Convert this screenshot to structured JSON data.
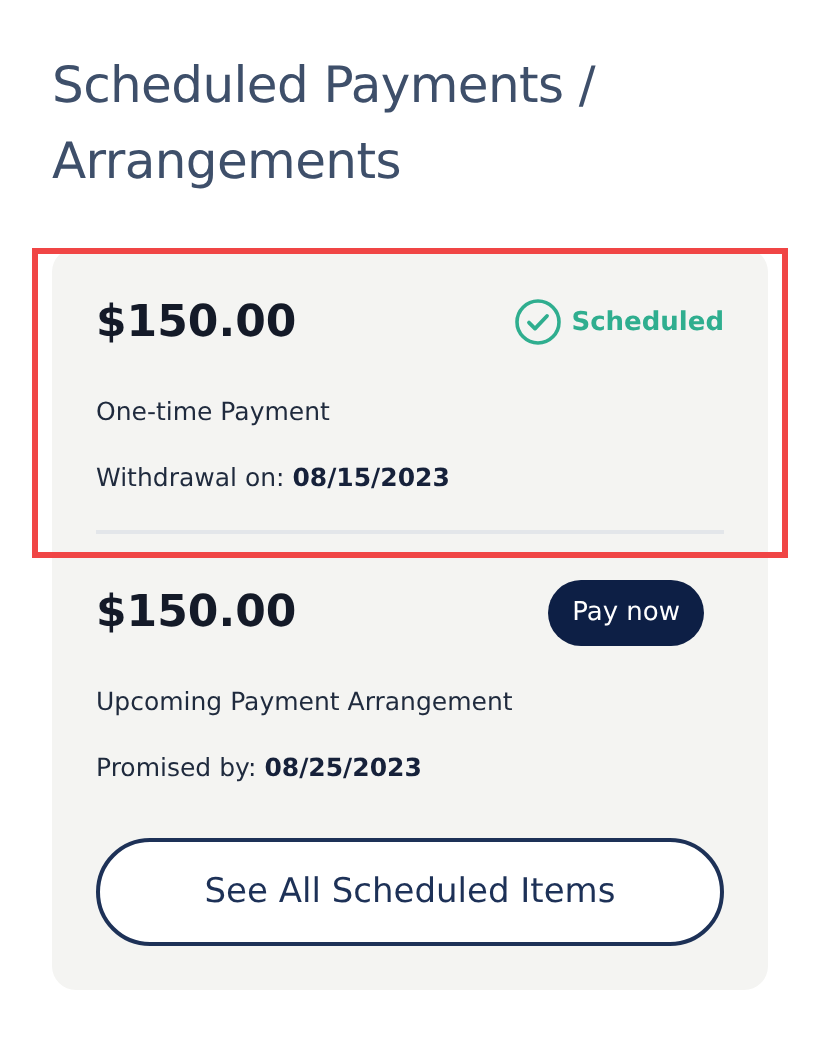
{
  "heading": "Scheduled Payments / Arrangements",
  "payments": [
    {
      "kind": "status",
      "highlighted": true,
      "amount": "$150.00",
      "status": "Scheduled",
      "type": "One-time Payment",
      "date_label": "Withdrawal on:",
      "date": "08/15/2023"
    },
    {
      "kind": "action",
      "highlighted": false,
      "amount": "$150.00",
      "action": "Pay now",
      "type": "Upcoming Payment Arrangement",
      "date_label": "Promised by:",
      "date": "08/25/2023"
    }
  ],
  "footer_button": "See All Scheduled Items"
}
